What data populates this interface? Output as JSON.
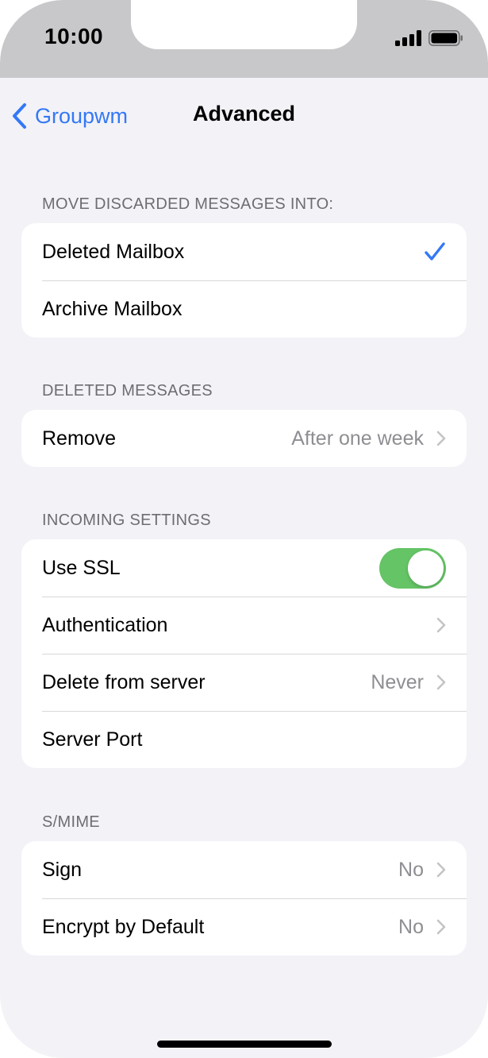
{
  "status_bar": {
    "time": "10:00"
  },
  "nav": {
    "back_label": "Groupwm",
    "title": "Advanced"
  },
  "sections": {
    "discarded": {
      "header": "MOVE DISCARDED MESSAGES INTO:",
      "deleted_mailbox": "Deleted Mailbox",
      "archive_mailbox": "Archive Mailbox",
      "selected": "Deleted Mailbox"
    },
    "deleted_messages": {
      "header": "DELETED MESSAGES",
      "remove_label": "Remove",
      "remove_value": "After one week"
    },
    "incoming": {
      "header": "INCOMING SETTINGS",
      "use_ssl_label": "Use SSL",
      "use_ssl_on": true,
      "authentication_label": "Authentication",
      "delete_from_server_label": "Delete from server",
      "delete_from_server_value": "Never",
      "server_port_label": "Server Port"
    },
    "smime": {
      "header": "S/MIME",
      "sign_label": "Sign",
      "sign_value": "No",
      "encrypt_label": "Encrypt by Default",
      "encrypt_value": "No"
    }
  },
  "colors": {
    "accent": "#3478f6",
    "toggle_on": "#65c466",
    "background": "#f2f2f7",
    "secondary_text": "#8e8e93"
  },
  "icons": [
    "signal-icon",
    "battery-icon",
    "back-chevron-icon",
    "checkmark-icon",
    "chevron-right-icon"
  ]
}
